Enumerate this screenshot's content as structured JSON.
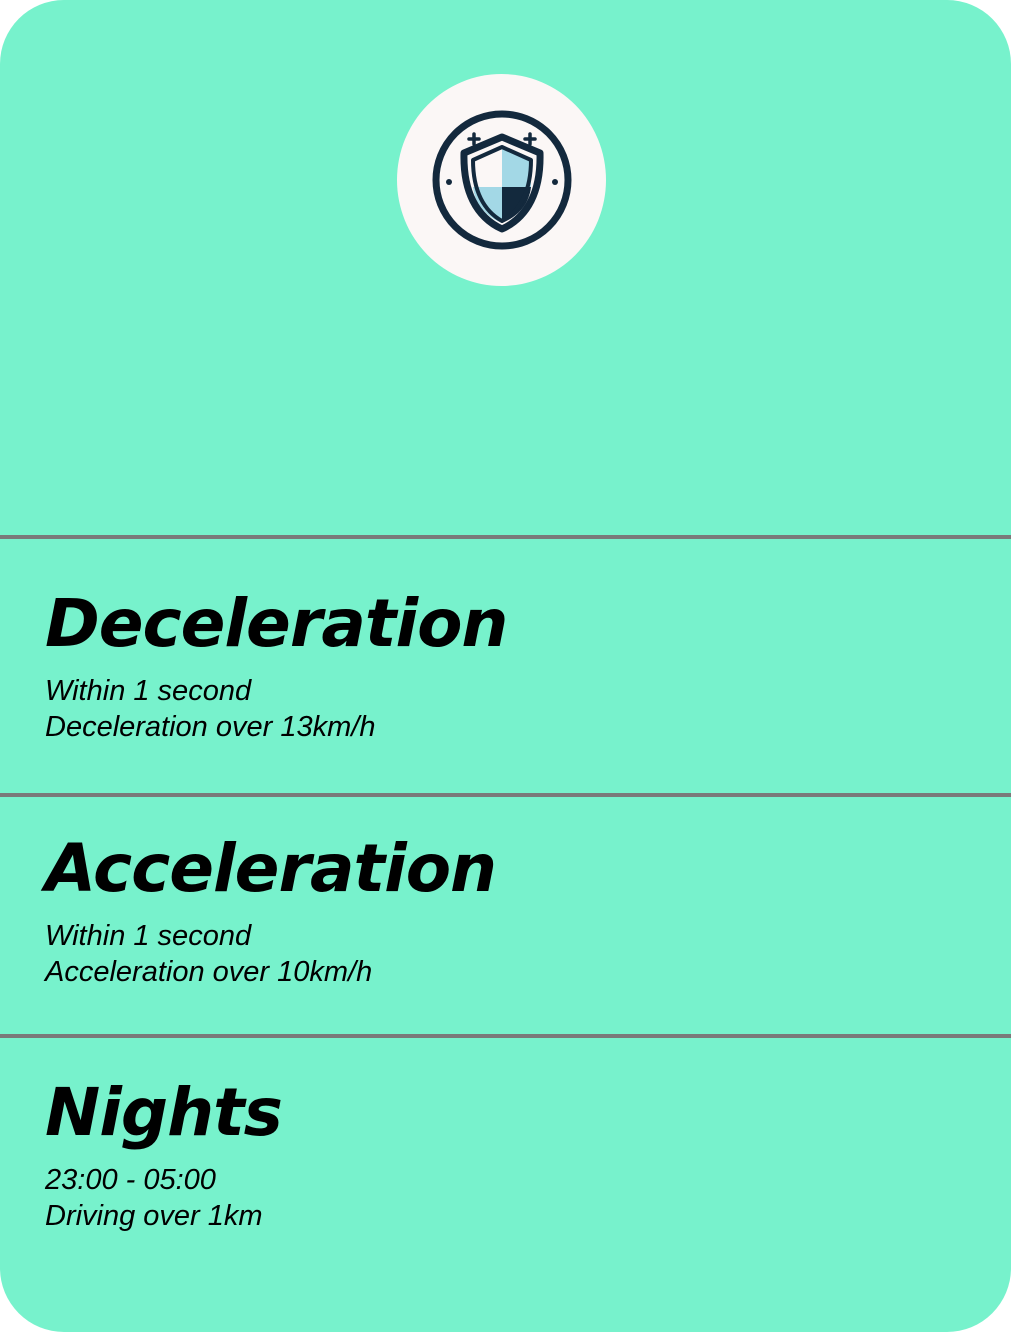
{
  "card": {
    "background": "#77f2cc",
    "divider_color": "#7a7a7a",
    "badge": {
      "icon": "shield-icon",
      "background": "#fbf7f6",
      "colors": {
        "stroke": "#13293d",
        "light": "#a3d8e6",
        "dark": "#13293d"
      }
    }
  },
  "sections": [
    {
      "title": "Deceleration",
      "lines": [
        "Within 1 second",
        "Deceleration over 13km/h"
      ]
    },
    {
      "title": "Acceleration",
      "lines": [
        "Within 1 second",
        "Acceleration over 10km/h"
      ]
    },
    {
      "title": "Nights",
      "lines": [
        "23:00 - 05:00",
        "Driving over 1km"
      ]
    }
  ]
}
